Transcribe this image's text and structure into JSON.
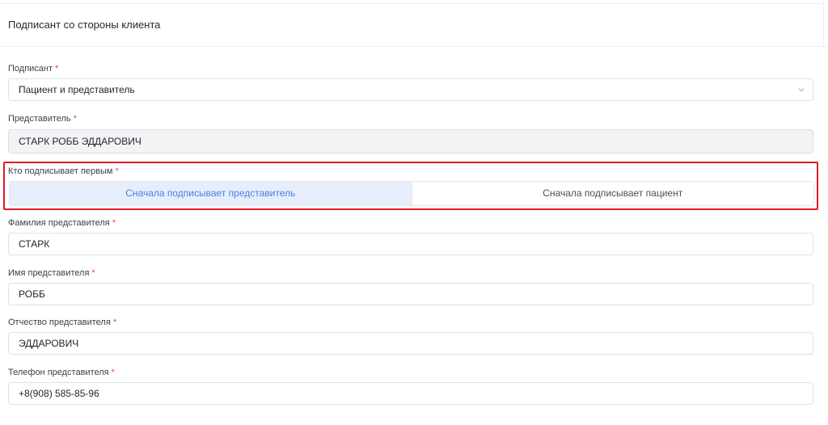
{
  "section": {
    "title": "Подписант со стороны клиента"
  },
  "required_mark": "*",
  "fields": {
    "signer": {
      "label": "Подписант",
      "value": "Пациент и представитель"
    },
    "representative": {
      "label": "Представитель",
      "value": "СТАРК РОББ ЭДДАРОВИЧ"
    },
    "who_signs_first": {
      "label": "Кто подписывает первым",
      "options": [
        "Сначала подписывает представитель",
        "Сначала подписывает пациент"
      ],
      "selected": "Сначала подписывает представитель"
    },
    "rep_last_name": {
      "label": "Фамилия представителя",
      "value": "СТАРК"
    },
    "rep_first_name": {
      "label": "Имя представителя",
      "value": "РОББ"
    },
    "rep_patronymic": {
      "label": "Отчество представителя",
      "value": "ЭДДАРОВИЧ"
    },
    "rep_phone": {
      "label": "Телефон представителя",
      "value": "+8(908) 585-85-96"
    }
  },
  "colors": {
    "required": "#e5484d",
    "selected_segment_bg": "#e6eefc",
    "selected_segment_text": "#4a7fe0",
    "highlight_border": "#e01a23"
  },
  "icons": {
    "select_chevron": "chevron-down-icon"
  }
}
